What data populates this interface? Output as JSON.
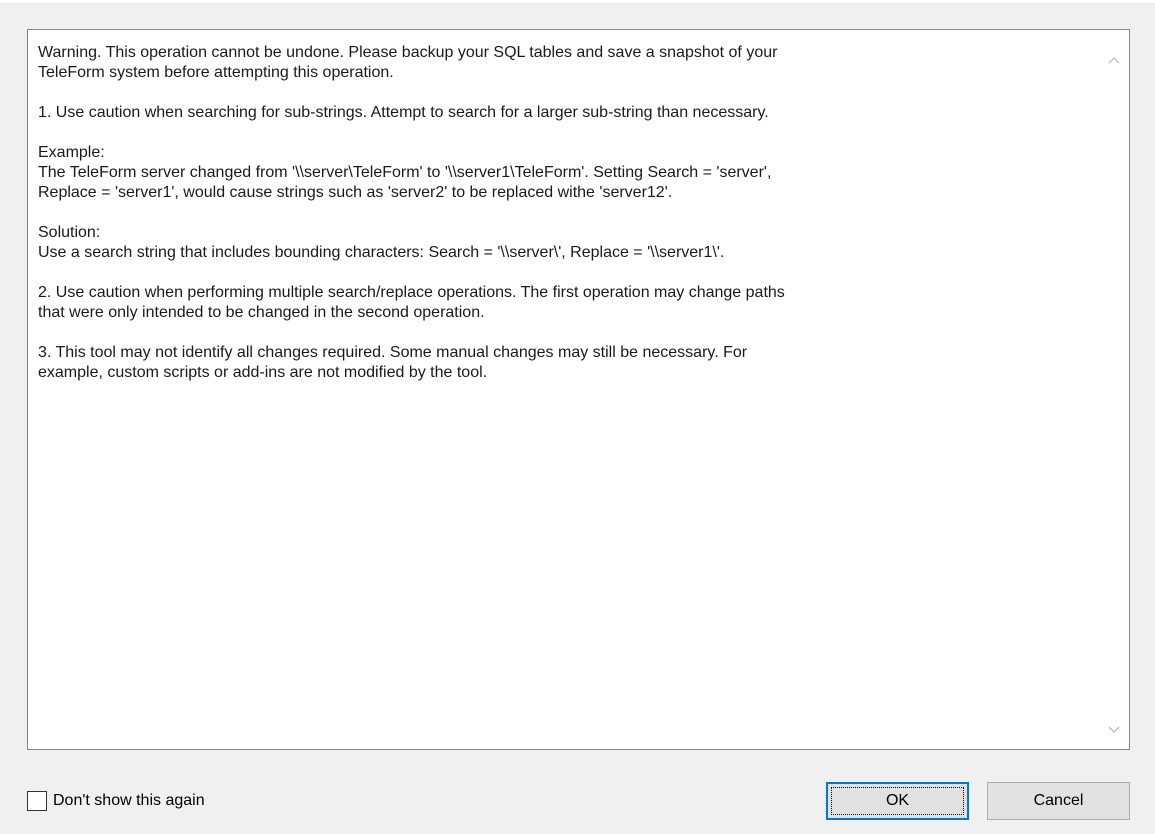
{
  "message": {
    "paragraphs": [
      "Warning.  This operation cannot be undone.  Please backup your SQL tables and save a snapshot of your\nTeleForm system before attempting this operation.",
      "1.  Use caution when searching for sub-strings.  Attempt to search for a larger sub-string than necessary.",
      "Example:\nThe TeleForm server changed from '\\\\server\\TeleForm' to '\\\\server1\\TeleForm'.  Setting Search = 'server',\nReplace = 'server1', would cause strings such as 'server2' to be replaced withe 'server12'.",
      "Solution:\nUse a search string that includes bounding characters: Search = '\\\\server\\', Replace = '\\\\server1\\'.",
      "2.  Use caution when performing multiple search/replace operations.  The first operation may change paths\nthat were only intended to be changed in the second operation.",
      "3.  This tool may not identify all changes required.  Some manual changes may still be necessary.  For\nexample, custom scripts or add-ins are not modified by the tool."
    ]
  },
  "footer": {
    "dont_show_label": "Don't show this again",
    "dont_show_checked": false,
    "ok_label": "OK",
    "cancel_label": "Cancel"
  },
  "icons": {
    "scroll_up": "chevron-up-icon",
    "scroll_down": "chevron-down-icon"
  }
}
